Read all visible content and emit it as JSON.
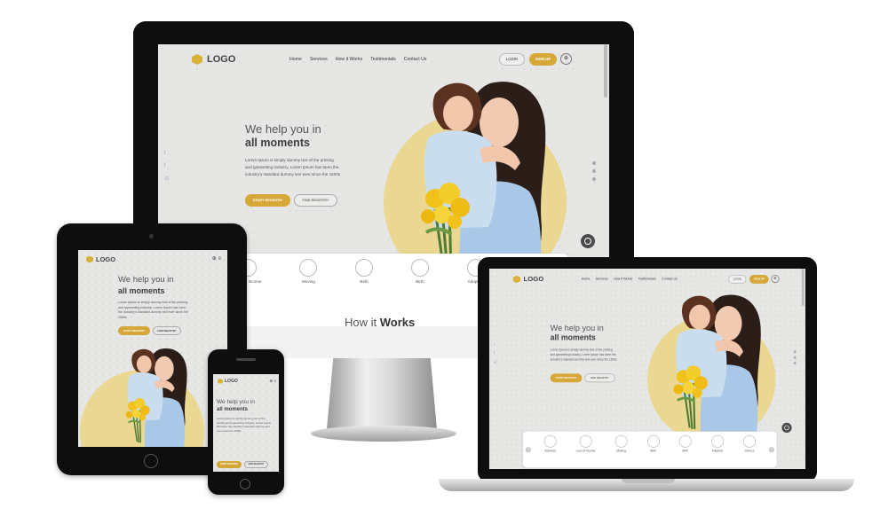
{
  "site": {
    "logo": "LOGO",
    "nav": [
      "Home",
      "Services",
      "How it Works",
      "Testimonials",
      "Contact Us"
    ],
    "login": "LOGIN",
    "signup": "SIGN UP",
    "hero_line1": "We help you in",
    "hero_line2": "all moments",
    "hero_text": "Lorem Ipsum is simply dummy text of the printing and typesetting industry. Lorem Ipsum has been the industry's standard dummy text ever since the 1500s",
    "btn_start": "START REGISTRY",
    "btn_find": "FIND REGISTRY",
    "services": [
      "Sickness",
      "Loss of Income",
      "Moving",
      "Birth",
      "Birth",
      "Adoption",
      "Divorce"
    ],
    "how_prefix": "How it",
    "how_bold": "Works"
  },
  "icons": {
    "social": [
      "twitter-icon",
      "facebook-icon",
      "instagram-icon"
    ],
    "cart": "cart-icon",
    "menu": "hamburger-icon"
  },
  "colors": {
    "accent": "#d6a83a",
    "circle": "#ead892",
    "hero_bg": "#e6e7e5",
    "bezel": "#111111"
  }
}
